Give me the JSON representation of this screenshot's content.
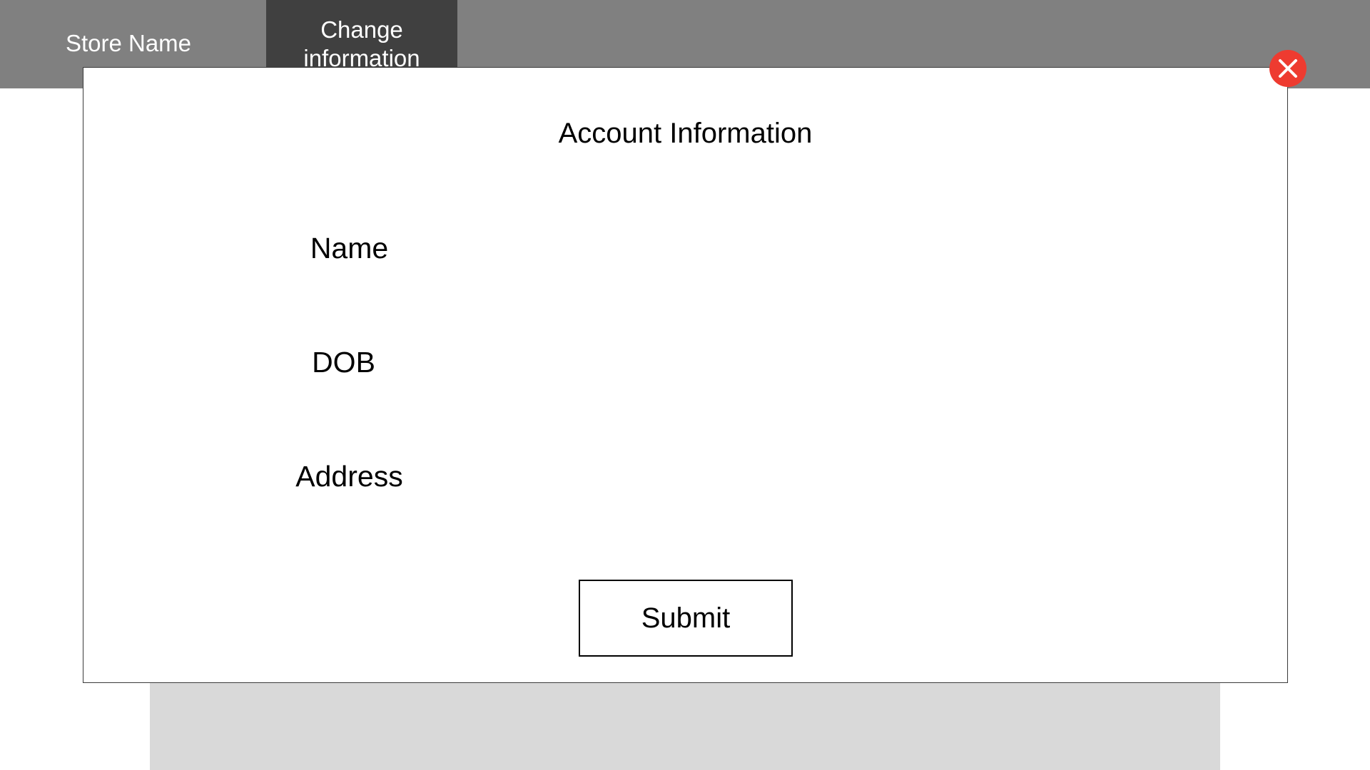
{
  "header": {
    "store_name": "Store Name",
    "active_tab_label": "Change information"
  },
  "modal": {
    "title": "Account Information",
    "fields": [
      {
        "label": "Name",
        "value": "",
        "placeholder": ""
      },
      {
        "label": "DOB",
        "value": "",
        "placeholder": ""
      },
      {
        "label": "Address",
        "value": "",
        "placeholder": ""
      }
    ],
    "submit_label": "Submit",
    "close_icon": "close-icon"
  },
  "colors": {
    "topbar": "#808080",
    "active_tab": "#404040",
    "close_button": "#ee3b30",
    "background_panel": "#d9d9d9"
  }
}
